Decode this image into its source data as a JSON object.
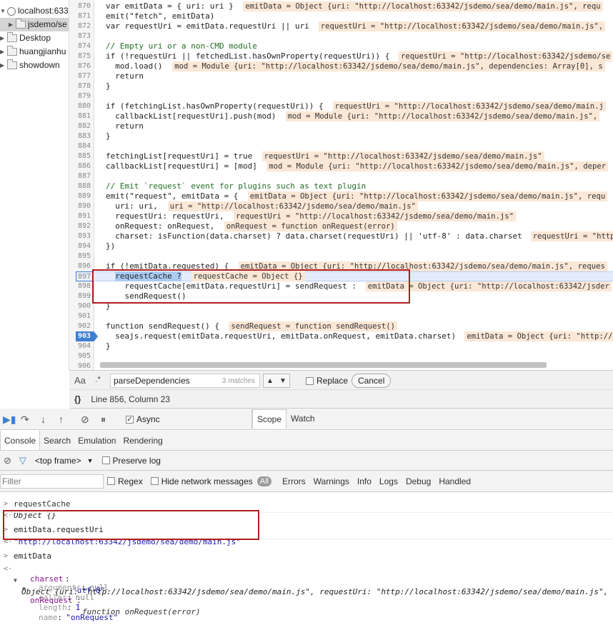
{
  "tree": {
    "host": "localhost:633",
    "items": [
      "jsdemo/se",
      "Desktop",
      "huangjianhu",
      "showdown"
    ]
  },
  "code": {
    "lines": [
      {
        "n": "870",
        "text": "var emitData = { uri: uri }",
        "ann": "emitData = Object {uri: \"http://localhost:63342/jsdemo/sea/demo/main.js\", requ"
      },
      {
        "n": "871",
        "text": "emit(\"fetch\", emitData)",
        "ann": ""
      },
      {
        "n": "872",
        "text": "var requestUri = emitData.requestUri || uri",
        "ann": "requestUri = \"http://localhost:63342/jsdemo/sea/demo/main.js\","
      },
      {
        "n": "873",
        "text": "",
        "ann": ""
      },
      {
        "n": "874",
        "text": "// Empty uri or a non-CMD module",
        "ann": ""
      },
      {
        "n": "875",
        "text": "if (!requestUri || fetchedList.hasOwnProperty(requestUri)) {",
        "ann": "requestUri = \"http://localhost:63342/jsdemo/se"
      },
      {
        "n": "876",
        "text": "  mod.load()",
        "ann": "mod = Module {uri: \"http://localhost:63342/jsdemo/sea/demo/main.js\", dependencies: Array[0], s"
      },
      {
        "n": "877",
        "text": "  return",
        "ann": ""
      },
      {
        "n": "878",
        "text": "}",
        "ann": ""
      },
      {
        "n": "879",
        "text": "",
        "ann": ""
      },
      {
        "n": "880",
        "text": "if (fetchingList.hasOwnProperty(requestUri)) {",
        "ann": "requestUri = \"http://localhost:63342/jsdemo/sea/demo/main.j"
      },
      {
        "n": "881",
        "text": "  callbackList[requestUri].push(mod)",
        "ann": "mod = Module {uri: \"http://localhost:63342/jsdemo/sea/demo/main.js\","
      },
      {
        "n": "882",
        "text": "  return",
        "ann": ""
      },
      {
        "n": "883",
        "text": "}",
        "ann": ""
      },
      {
        "n": "884",
        "text": "",
        "ann": ""
      },
      {
        "n": "885",
        "text": "fetchingList[requestUri] = true",
        "ann": "requestUri = \"http://localhost:63342/jsdemo/sea/demo/main.js\""
      },
      {
        "n": "886",
        "text": "callbackList[requestUri] = [mod]",
        "ann": "mod = Module {uri: \"http://localhost:63342/jsdemo/sea/demo/main.js\", deper"
      },
      {
        "n": "887",
        "text": "",
        "ann": ""
      },
      {
        "n": "888",
        "text": "// Emit `request` event for plugins such as text plugin",
        "ann": ""
      },
      {
        "n": "889",
        "text": "emit(\"request\", emitData = {",
        "ann": "emitData = Object {uri: \"http://localhost:63342/jsdemo/sea/demo/main.js\", requ"
      },
      {
        "n": "890",
        "text": "  uri: uri,",
        "ann": "uri = \"http://localhost:63342/jsdemo/sea/demo/main.js\""
      },
      {
        "n": "891",
        "text": "  requestUri: requestUri,",
        "ann": "requestUri = \"http://localhost:63342/jsdemo/sea/demo/main.js\""
      },
      {
        "n": "892",
        "text": "  onRequest: onRequest,",
        "ann": "onRequest = function onRequest(error)"
      },
      {
        "n": "893",
        "text": "  charset: isFunction(data.charset) ? data.charset(requestUri) || 'utf-8' : data.charset",
        "ann": "requestUri = \"http"
      },
      {
        "n": "894",
        "text": "})",
        "ann": ""
      },
      {
        "n": "895",
        "text": "",
        "ann": ""
      },
      {
        "n": "896",
        "text": "if (!emitData.requested) {",
        "ann": "emitData = Object {uri: \"http://localhost:63342/jsdemo/sea/demo/main.js\", reques"
      },
      {
        "n": "897",
        "text": "  requestCache ?",
        "ann": "requestCache = Object {}"
      },
      {
        "n": "898",
        "text": "    requestCache[emitData.requestUri] = sendRequest :",
        "ann": "emitData = Object {uri: \"http://localhost:63342/jsder"
      },
      {
        "n": "899",
        "text": "    sendRequest()",
        "ann": ""
      },
      {
        "n": "900",
        "text": "}",
        "ann": ""
      },
      {
        "n": "901",
        "text": "",
        "ann": ""
      },
      {
        "n": "902",
        "text": "function sendRequest() {",
        "ann": "sendRequest = function sendRequest()"
      },
      {
        "n": "903",
        "text": "  seajs.request(emitData.requestUri, emitData.onRequest, emitData.charset)",
        "ann": "emitData = Object {uri: \"http://l"
      },
      {
        "n": "904",
        "text": "}",
        "ann": ""
      },
      {
        "n": "905",
        "text": "",
        "ann": ""
      },
      {
        "n": "906",
        "text": "",
        "ann": ""
      }
    ]
  },
  "search": {
    "aa_label": "Aa",
    "regex_label": ".*",
    "query": "parseDependencies",
    "matches": "3 matches",
    "replace_label": "Replace",
    "cancel_label": "Cancel"
  },
  "status": {
    "braces": "{}",
    "position": "Line 856, Column 23"
  },
  "debugger": {
    "async_label": "Async",
    "tabs": [
      "Scope",
      "Watch"
    ]
  },
  "drawer": {
    "tabs": [
      "Console",
      "Search",
      "Emulation",
      "Rendering"
    ],
    "frame": "<top frame>",
    "preserve_log": "Preserve log",
    "filter_placeholder": "Filter",
    "regex": "Regex",
    "hide_network": "Hide network messages",
    "levels": [
      "All",
      "Errors",
      "Warnings",
      "Info",
      "Logs",
      "Debug",
      "Handled"
    ]
  },
  "console": {
    "partial_top": "requestCache",
    "r1": "Object {}",
    "cmd1": "emitData.requestUri",
    "res1": "\"http://localhost:63342/jsdemo/sea/demo/main.js\"",
    "cmd2": "emitData",
    "obj": "Object {uri: \"http://localhost:63342/jsdemo/sea/demo/main.js\", requestUri: \"http://localhost:63342/jsdemo/sea/demo/main.js\", c",
    "charset_key": "charset",
    "charset_val": "\"utf-8\"",
    "onrequest_key": "onRequest",
    "onrequest_val": "function onRequest(error)",
    "props": [
      {
        "k": "arguments",
        "v": "null"
      },
      {
        "k": "caller",
        "v": "null"
      },
      {
        "k": "length",
        "v": "1"
      },
      {
        "k": "name",
        "v": "\"onRequest\""
      }
    ]
  },
  "colors": {
    "accent": "#3d7fd3",
    "annotation_bg": "#fbe7d6",
    "highlight_box": "#b21e1e"
  }
}
